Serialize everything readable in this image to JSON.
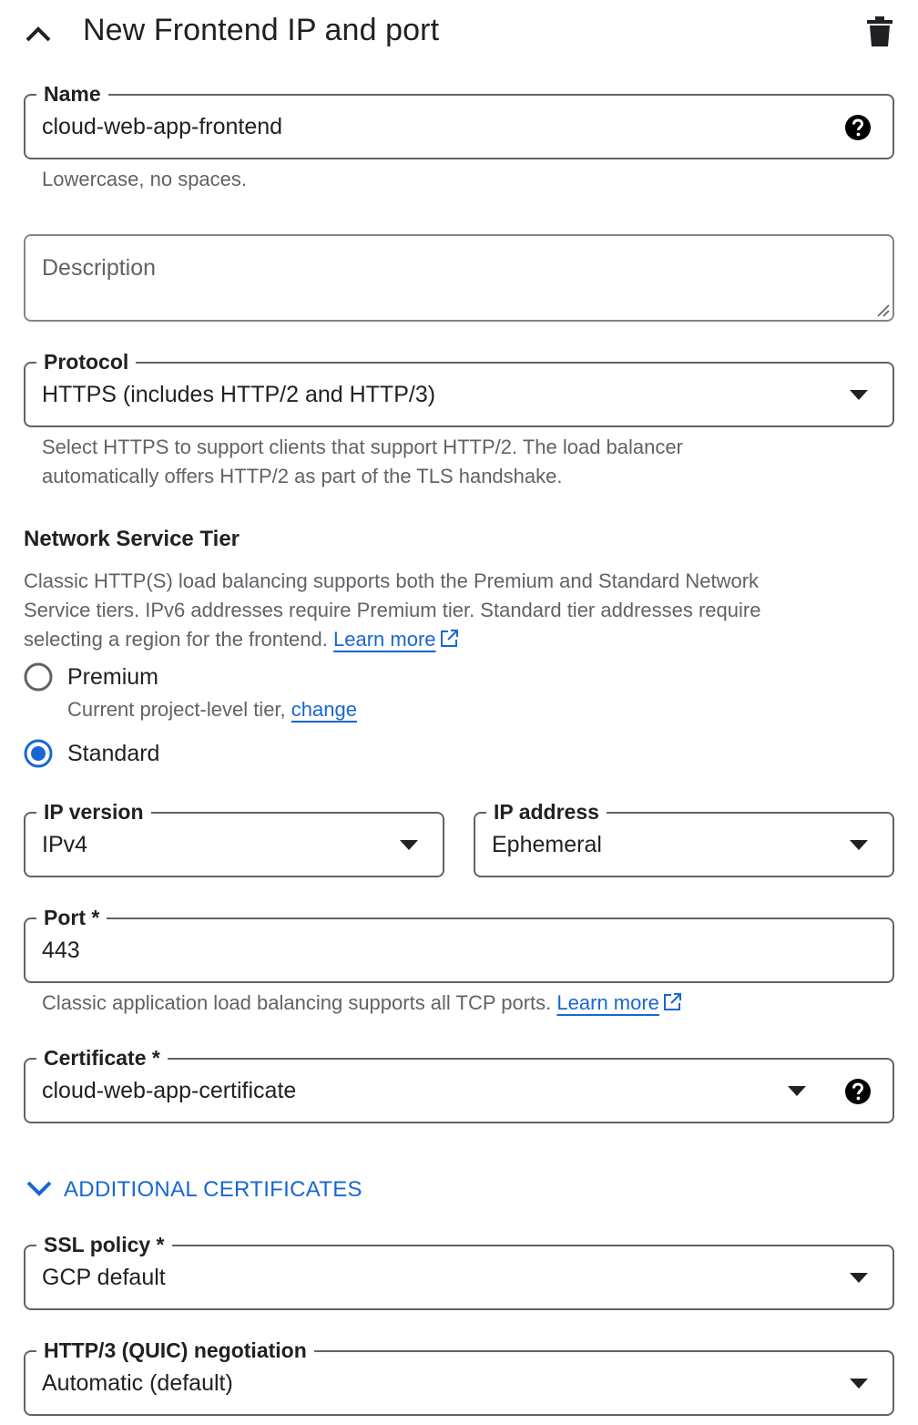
{
  "panel": {
    "title": "New Frontend IP and port",
    "collapse_icon": "chevron-up-icon",
    "delete_icon": "trash-icon"
  },
  "name_field": {
    "label": "Name",
    "value": "cloud-web-app-frontend",
    "hint": "Lowercase, no spaces.",
    "help_icon": "help-circle-icon"
  },
  "description_field": {
    "placeholder": "Description"
  },
  "protocol_field": {
    "label": "Protocol",
    "value": "HTTPS (includes HTTP/2 and HTTP/3)",
    "hint_line1": "Select HTTPS to support clients that support HTTP/2. The load balancer",
    "hint_line2": "automatically offers HTTP/2 as part of the TLS handshake."
  },
  "network_tier": {
    "title": "Network Service Tier",
    "description_line1": "Classic HTTP(S) load balancing supports both the Premium and Standard Network",
    "description_line2": "Service tiers. IPv6 addresses require Premium tier. Standard tier addresses require",
    "description_line3": "selecting a region for the frontend.",
    "learn_more": "Learn more",
    "options": [
      {
        "label": "Premium",
        "sub": "Current project-level tier,",
        "sub_link": "change",
        "selected": false
      },
      {
        "label": "Standard",
        "selected": true
      }
    ]
  },
  "ip_version_field": {
    "label": "IP version",
    "value": "IPv4"
  },
  "ip_address_field": {
    "label": "IP address",
    "value": "Ephemeral"
  },
  "port_field": {
    "label": "Port *",
    "value": "443",
    "hint": "Classic application load balancing supports all TCP ports.",
    "learn_more": "Learn more"
  },
  "certificate_field": {
    "label": "Certificate *",
    "value": "cloud-web-app-certificate"
  },
  "additional_certificates": {
    "label": "ADDITIONAL CERTIFICATES",
    "icon": "chevron-down-icon"
  },
  "ssl_policy_field": {
    "label": "SSL policy *",
    "value": "GCP default"
  },
  "quic_field": {
    "label": "HTTP/3 (QUIC) negotiation",
    "value": "Automatic (default)"
  },
  "colors": {
    "accent": "#1967d2",
    "text": "#202124",
    "secondary_text": "#5f6368",
    "border": "#5f6368"
  }
}
